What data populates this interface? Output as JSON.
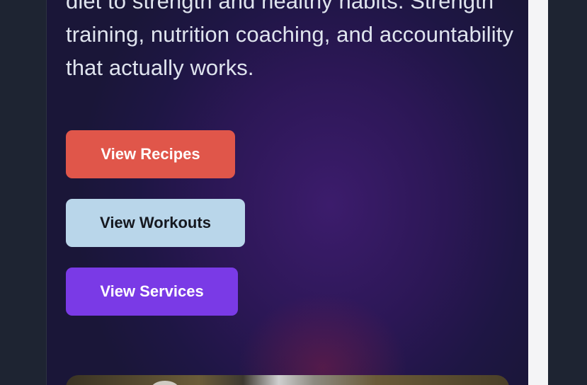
{
  "hero": {
    "text": "diet to strength and healthy habits. Strength training, nutrition coaching, and accountability that actually works."
  },
  "buttons": {
    "recipes_label": "View Recipes",
    "workouts_label": "View Workouts",
    "services_label": "View Services"
  },
  "colors": {
    "recipes_button": "#e0564a",
    "workouts_button": "#b9d6ea",
    "services_button": "#7a3ae6",
    "hero_background": "#2c1756"
  }
}
